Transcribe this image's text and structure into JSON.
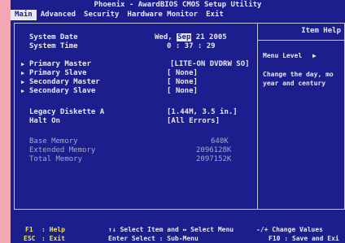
{
  "title": "Phoenix - AwardBIOS CMOS Setup Utility",
  "menu": [
    "Main",
    "Advanced",
    "Security",
    "Hardware Monitor",
    "Exit"
  ],
  "main": {
    "system_date_label": "System Date",
    "system_date_day": "Wed,",
    "system_date_month": "Sep",
    "system_date_rest": "21 2005",
    "system_time_label": "System Time",
    "system_time_value": "0 : 37 : 29",
    "primary_master_label": "Primary Master",
    "primary_master_value": "[LITE-ON DVDRW SO]",
    "primary_slave_label": "Primary Slave",
    "primary_slave_value": "[ None]",
    "secondary_master_label": "Secondary Master",
    "secondary_master_value": "[ None]",
    "secondary_slave_label": "Secondary Slave",
    "secondary_slave_value": "[ None]",
    "legacy_diskette_label": "Legacy Diskette A",
    "legacy_diskette_value": "[1.44M, 3.5 in.]",
    "halt_on_label": "Halt On",
    "halt_on_value": "[All Errors]",
    "base_memory_label": "Base Memory",
    "base_memory_value": "640K",
    "extended_memory_label": "Extended Memory",
    "extended_memory_value": "2096128K",
    "total_memory_label": "Total Memory",
    "total_memory_value": "2097152K"
  },
  "help": {
    "title": "Item Help",
    "menu_level": "Menu Level",
    "menu_level_arrow": "▶",
    "text": "Change the day, mo\nyear and century"
  },
  "footer": {
    "f1_key": "F1",
    "f1_label": ": Help",
    "esc_key": "ESC",
    "esc_label": ": Exit",
    "select_item": "↑↓ Select Item and ↔ Select Menu",
    "enter_select": "Enter Select : Sub-Menu",
    "change_values": "-/+ Change Values",
    "f10": "F10 : Save and Exi"
  },
  "colors": {
    "background": "#1c1e8e",
    "text": "#e8e8f2",
    "footer_keys": "#f0e060"
  }
}
